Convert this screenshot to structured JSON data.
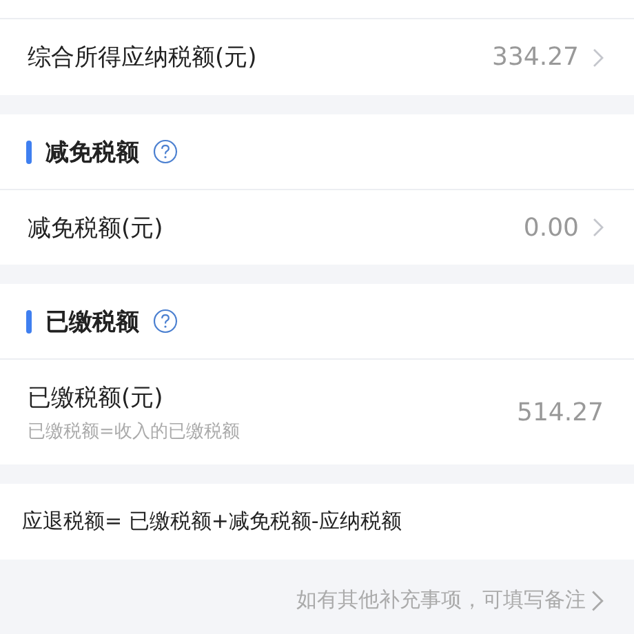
{
  "top_row": {
    "label": "综合所得应纳税额(元)",
    "value": "334.27",
    "chevron": true
  },
  "sections": [
    {
      "title": "减免税额",
      "items": [
        {
          "label": "减免税额(元)",
          "value": "0.00",
          "chevron": true
        }
      ]
    },
    {
      "title": "已缴税额",
      "items": [
        {
          "label": "已缴税额(元)",
          "note": "已缴税额=收入的已缴税额",
          "value": "514.27",
          "chevron": false
        }
      ]
    }
  ],
  "formula": "应退税额= 已缴税额+减免税额-应纳税额",
  "remark_link": "如有其他补充事项，可填写备注"
}
